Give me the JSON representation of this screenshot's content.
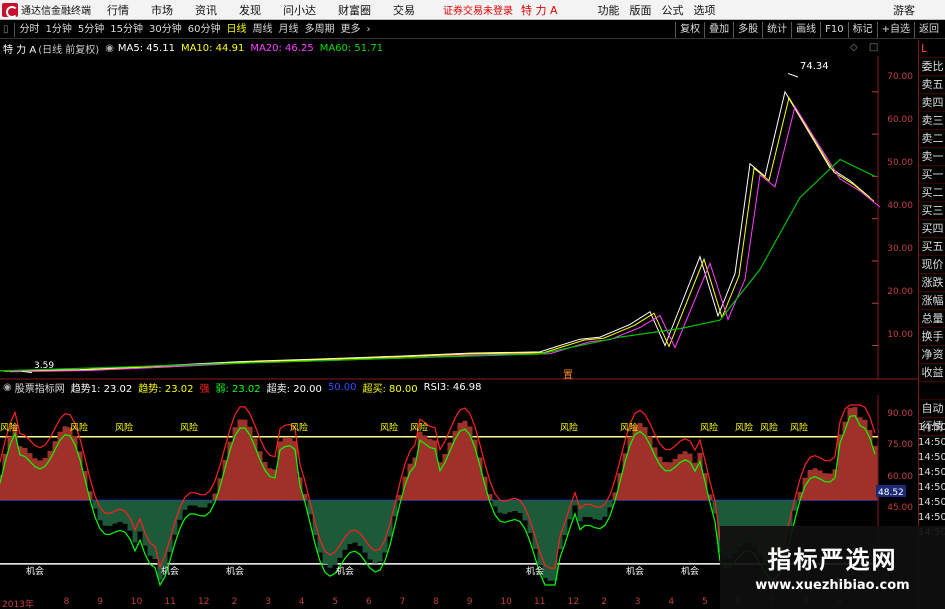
{
  "menubar": {
    "app_title": "通达信金融终端",
    "items": [
      "行情",
      "市场",
      "资讯",
      "发现",
      "问小达",
      "财富圈",
      "交易"
    ],
    "warning": "证券交易未登录",
    "stock_name": "特 力 A",
    "right_items": [
      "功能",
      "版面",
      "公式",
      "选项"
    ],
    "guest": "游客"
  },
  "toolbar": {
    "periods": [
      "分时",
      "1分钟",
      "5分钟",
      "15分钟",
      "30分钟",
      "60分钟",
      "日线",
      "周线",
      "月线",
      "多周期",
      "更多"
    ],
    "active_period": "日线",
    "right_buttons": [
      "复权",
      "叠加",
      "多股",
      "统计",
      "画线",
      "F10",
      "标记",
      "+自选",
      "返回"
    ]
  },
  "main_chart": {
    "title": "特 力 A",
    "subtitle": "(日线 前复权)",
    "ma": [
      {
        "label": "MA5: 45.11",
        "color": "#ffffff"
      },
      {
        "label": "MA10: 44.91",
        "color": "#ffff00"
      },
      {
        "label": "MA20: 46.25",
        "color": "#ff40ff"
      },
      {
        "label": "MA60: 51.71",
        "color": "#00e000"
      }
    ],
    "high_label": "74.34",
    "low_label": "3.59",
    "marker": "置",
    "y_ticks": [
      "70.00",
      "60.00",
      "50.00",
      "40.00",
      "30.00",
      "20.00",
      "10.00"
    ]
  },
  "indicator": {
    "name": "股票指标网",
    "fields": [
      {
        "label": "趋势1: 23.02",
        "color": "#ffffff"
      },
      {
        "label": "趋势: 23.02",
        "color": "#ffff00"
      },
      {
        "label": "强",
        "color": "#ff2020"
      },
      {
        "label": "弱: 23.02",
        "color": "#00ff00"
      },
      {
        "label": "超卖: 20.00",
        "color": "#ffffff"
      },
      {
        "label": "50.00",
        "color": "#3050ff"
      },
      {
        "label": "超买: 80.00",
        "color": "#ffff00"
      },
      {
        "label": "RSI3: 46.98",
        "color": "#ffffff"
      }
    ],
    "y_ticks": [
      "90.00",
      "75.00",
      "60.00",
      "45.00"
    ],
    "current_value": "48.52",
    "risk_label": "风险",
    "chance_label": "机会"
  },
  "sidebar": {
    "top": "L",
    "items": [
      "委比",
      "卖五",
      "卖四",
      "卖三",
      "卖二",
      "卖一",
      "买一",
      "买二",
      "买三",
      "买四",
      "买五",
      "现价",
      "涨跌",
      "涨幅",
      "总量",
      "换手",
      "净资",
      "收益",
      "",
      "自动",
      "行情"
    ],
    "right_time_labels": [
      "14:50",
      "14:50",
      "14:50",
      "14:50",
      "14:50",
      "14:50",
      "14:50",
      "14:50"
    ]
  },
  "date_axis": {
    "labels": [
      "2013年",
      "8",
      "9",
      "10",
      "11",
      "12",
      "2",
      "3",
      "4",
      "5",
      "6",
      "7",
      "8",
      "9",
      "10",
      "11",
      "12",
      "2",
      "3",
      "4",
      "5",
      "6",
      "7",
      "8",
      "9"
    ]
  },
  "watermark": {
    "title": "指标严选网",
    "url": "www.xuezhibiao.com"
  },
  "colors": {
    "up": "#ff3030",
    "down": "#00ff00",
    "axis": "#c04040",
    "grid": "#5a0000"
  }
}
